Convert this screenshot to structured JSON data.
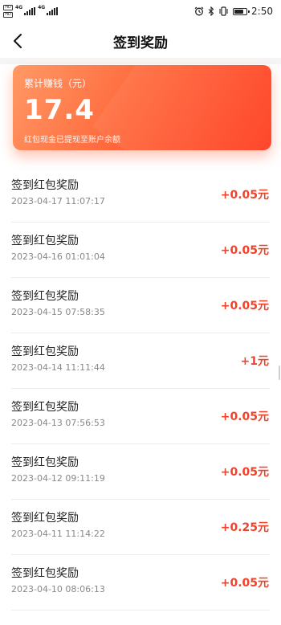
{
  "status_bar": {
    "sim1": "HD",
    "sim2": "HD",
    "net1": "4G",
    "net2": "4G",
    "time": "2:50"
  },
  "nav": {
    "title": "签到奖励"
  },
  "summary": {
    "label": "累计赚钱（元）",
    "amount": "17.4",
    "note": "红包现金已提现至账户余额"
  },
  "records": [
    {
      "title": "签到红包奖励",
      "time": "2023-04-17 11:07:17",
      "amount": "+0.05元"
    },
    {
      "title": "签到红包奖励",
      "time": "2023-04-16 01:01:04",
      "amount": "+0.05元"
    },
    {
      "title": "签到红包奖励",
      "time": "2023-04-15 07:58:35",
      "amount": "+0.05元"
    },
    {
      "title": "签到红包奖励",
      "time": "2023-04-14 11:11:44",
      "amount": "+1元"
    },
    {
      "title": "签到红包奖励",
      "time": "2023-04-13 07:56:53",
      "amount": "+0.05元"
    },
    {
      "title": "签到红包奖励",
      "time": "2023-04-12 09:11:19",
      "amount": "+0.05元"
    },
    {
      "title": "签到红包奖励",
      "time": "2023-04-11 11:14:22",
      "amount": "+0.25元"
    },
    {
      "title": "签到红包奖励",
      "time": "2023-04-10 08:06:13",
      "amount": "+0.05元"
    }
  ],
  "colors": {
    "accent": "#f0432a",
    "card_start": "#ff9a66",
    "card_end": "#ff3b1f"
  },
  "icons": {
    "back": "chevron-left-icon",
    "alarm": "alarm-icon",
    "bluetooth": "bluetooth-icon",
    "vibrate": "vibrate-icon",
    "battery": "battery-icon"
  }
}
